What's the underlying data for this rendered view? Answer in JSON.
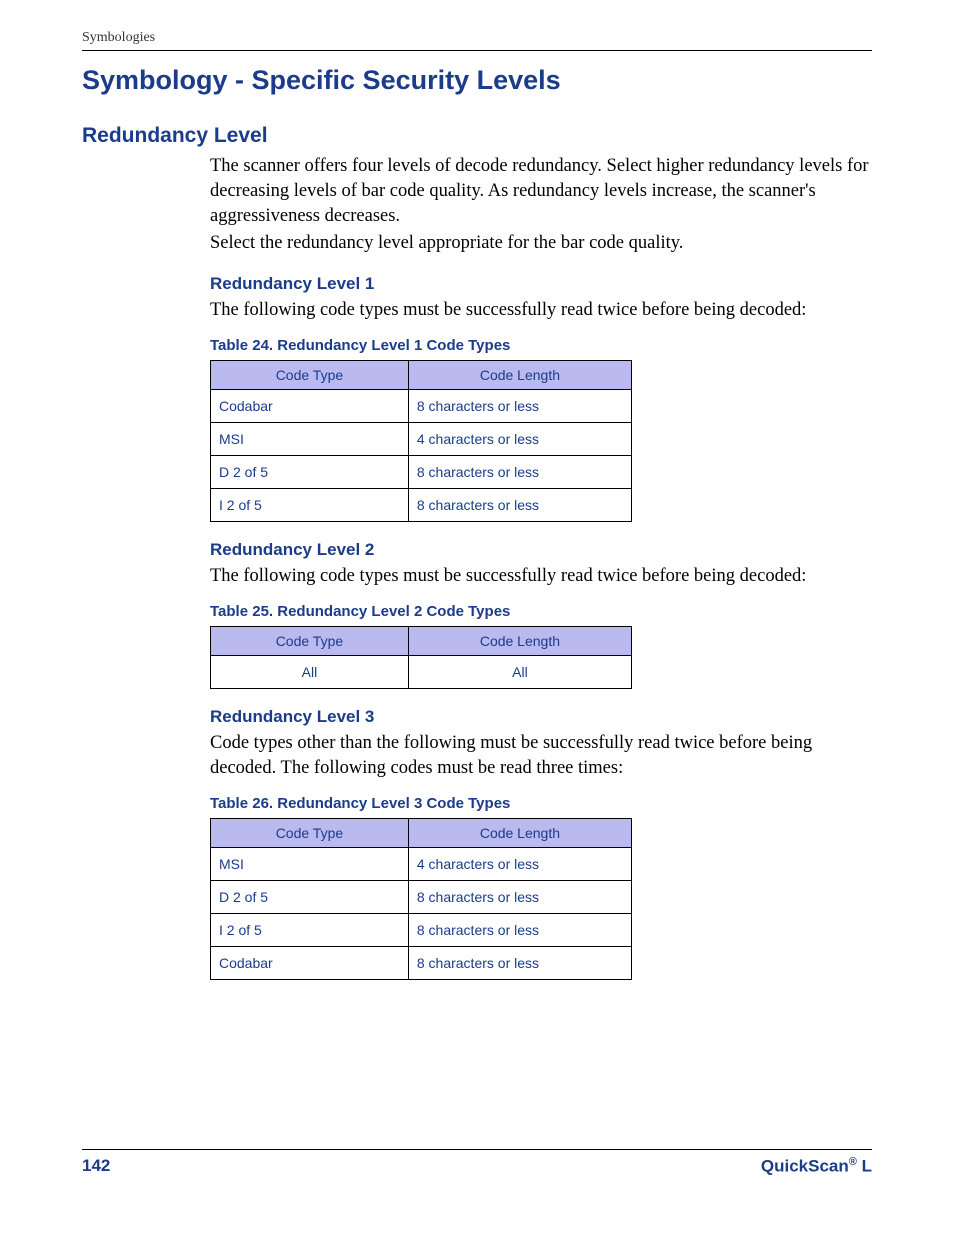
{
  "header": {
    "running_head": "Symbologies"
  },
  "title": "Symbology - Specific Security Levels",
  "section": {
    "heading": "Redundancy Level",
    "para1": "The scanner offers four levels of decode redundancy. Select higher redundancy levels for decreasing levels of bar code quality. As redundancy levels increase, the scanner's aggressiveness decreases.",
    "para2": "Select the redundancy level appropriate for the bar code quality."
  },
  "level1": {
    "heading": "Redundancy Level 1",
    "para": "The following code types must be successfully read twice before being decoded:",
    "caption": "Table 24. Redundancy Level 1 Code Types",
    "col1": "Code Type",
    "col2": "Code Length",
    "rows": [
      {
        "type": "Codabar",
        "len": "8 characters or less"
      },
      {
        "type": "MSI",
        "len": "4 characters or less"
      },
      {
        "type": "D 2 of 5",
        "len": "8 characters or less"
      },
      {
        "type": "I 2 of 5",
        "len": "8 characters or less"
      }
    ]
  },
  "level2": {
    "heading": "Redundancy Level 2",
    "para": "The following code types must be successfully read twice before being decoded:",
    "caption": "Table 25. Redundancy Level 2 Code Types",
    "col1": "Code Type",
    "col2": "Code Length",
    "rows": [
      {
        "type": "All",
        "len": "All"
      }
    ]
  },
  "level3": {
    "heading": "Redundancy Level 3",
    "para": "Code types other than the following must be successfully read twice before being decoded. The following codes must be read three times:",
    "caption": "Table 26. Redundancy Level 3 Code Types",
    "col1": "Code Type",
    "col2": "Code Length",
    "rows": [
      {
        "type": "MSI",
        "len": "4 characters or less"
      },
      {
        "type": "D 2 of 5",
        "len": "8 characters or less"
      },
      {
        "type": "I 2 of 5",
        "len": "8 characters or less"
      },
      {
        "type": "Codabar",
        "len": "8 characters or less"
      }
    ]
  },
  "footer": {
    "page": "142",
    "product_prefix": "QuickScan",
    "product_reg": "®",
    "product_suffix": " L"
  }
}
